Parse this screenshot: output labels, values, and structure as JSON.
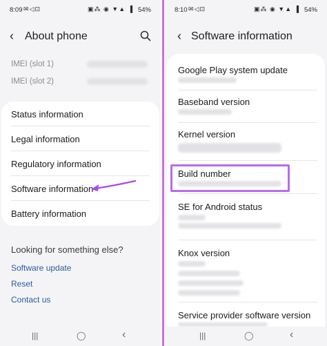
{
  "left": {
    "status": {
      "time": "8:09",
      "icons_left": "✉◁⊡",
      "icons_right": "▣⁂ ◉ ▼▲ ▐",
      "battery": "54%"
    },
    "header": {
      "title": "About phone",
      "back": "‹"
    },
    "imei": [
      {
        "label": "IMEI (slot 1)"
      },
      {
        "label": "IMEI (slot 2)"
      }
    ],
    "menu": [
      {
        "label": "Status information"
      },
      {
        "label": "Legal information"
      },
      {
        "label": "Regulatory information"
      },
      {
        "label": "Software information"
      },
      {
        "label": "Battery information"
      }
    ],
    "looking": {
      "heading": "Looking for something else?",
      "links": [
        {
          "label": "Software update"
        },
        {
          "label": "Reset"
        },
        {
          "label": "Contact us"
        }
      ]
    },
    "nav": {
      "recents": "|||",
      "home": "◯",
      "back": "‹"
    }
  },
  "right": {
    "status": {
      "time": "8:10",
      "icons_left": "✉◁⊡",
      "icons_right": "▣⁂ ◉ ▼▲ ▐",
      "battery": "54%"
    },
    "header": {
      "title": "Software information",
      "back": "‹"
    },
    "items": [
      {
        "label": "Google Play system update"
      },
      {
        "label": "Baseband version"
      },
      {
        "label": "Kernel version"
      },
      {
        "label": "Build number"
      },
      {
        "label": "SE for Android status"
      },
      {
        "label": "Knox version"
      },
      {
        "label": "Service provider software version"
      }
    ],
    "nav": {
      "recents": "|||",
      "home": "◯",
      "back": "‹"
    }
  },
  "colors": {
    "accent_link": "#2c5aa0",
    "arrow": "#a64cf0",
    "highlight": "#b96af0"
  }
}
